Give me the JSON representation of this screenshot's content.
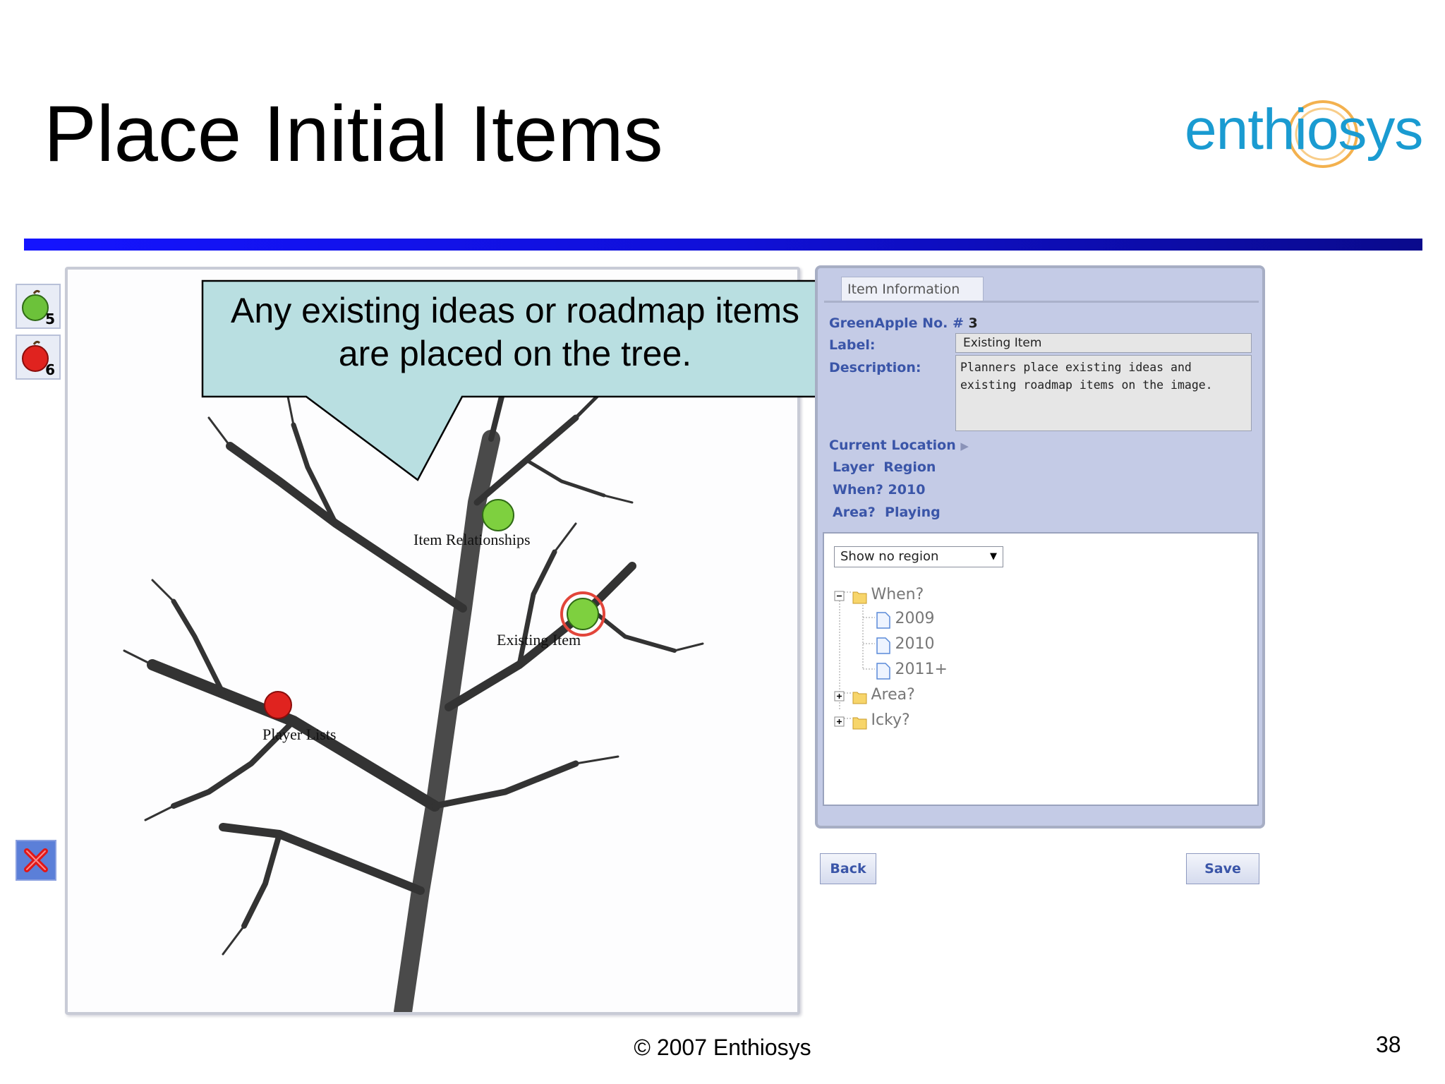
{
  "slide": {
    "title": "Place Initial Items",
    "logo_text": "enthiosys",
    "footer": "© 2007 Enthiosys",
    "page_number": "38"
  },
  "toolbar": {
    "green_apple_count": "5",
    "red_apple_count": "6"
  },
  "callout": {
    "line1": "Any existing ideas or roadmap items",
    "line2": "are placed on the tree."
  },
  "tree_items": {
    "item1": "Item Relationships",
    "item2": "Existing Item",
    "item3": "Player Lists"
  },
  "panel": {
    "tab_label": "Item Information",
    "item_kind": "GreenApple No. #",
    "item_number": "3",
    "label_caption": "Label:",
    "label_value": "Existing Item",
    "description_caption": "Description:",
    "description_value": "Planners place existing ideas and existing roadmap items on the image.",
    "location_caption": "Current Location",
    "layer_caption": "Layer",
    "layer_value": "Region",
    "when_caption": "When?",
    "when_value": "2010",
    "area_caption": "Area?",
    "area_value": "Playing"
  },
  "region_select": {
    "selected": "Show no region"
  },
  "tree_nodes": {
    "when": "When?",
    "y2009": "2009",
    "y2010": "2010",
    "y2011": "2011+",
    "area": "Area?",
    "icky": "Icky?"
  },
  "buttons": {
    "back": "Back",
    "save": "Save"
  },
  "colors": {
    "panel_bg": "#c4cbe6",
    "label_blue": "#3a55a8",
    "rule_blue": "#1414ff",
    "callout_fill": "#b9dfe1",
    "logo_blue": "#1a9bd1",
    "logo_orange": "#f2a93b"
  }
}
